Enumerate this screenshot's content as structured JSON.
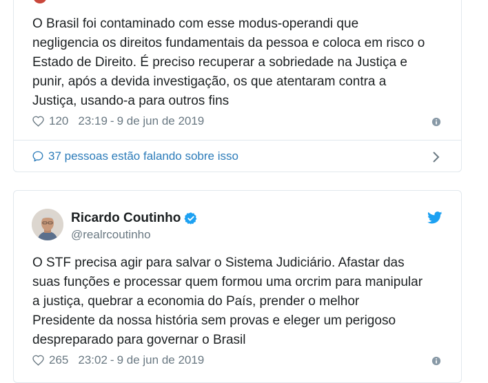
{
  "tweet1": {
    "text": "O Brasil foi contaminado com esse modus-operandi que\nnegligencia os direitos fundamentais da pessoa e coloca em risco o\nEstado de Direito. É preciso recuperar a sobriedade na Justiça e\npunir, após a devida investigação, os que atentaram contra a\nJustiça, usando-a para outros fins",
    "likes": "120",
    "time": "23:19",
    "date": "9 de jun de 2019",
    "conversation": "37 pessoas estão falando sobre isso"
  },
  "tweet2": {
    "author_name": "Ricardo Coutinho",
    "author_handle": "@realrcoutinho",
    "text": "O STF precisa agir para salvar o Sistema Judiciário. Afastar das\nsuas funções e processar quem formou uma orcrim para manipular\na justiça, quebrar a economia do País, prender o melhor\nPresidente da nossa história sem provas e eleger um perigoso\ndespreparado para governar o Brasil",
    "likes": "265",
    "time": "23:02",
    "date": "9 de jun de 2019"
  },
  "separator": "-",
  "icons": {
    "like": "heart-icon",
    "info": "info-icon",
    "conversation": "speech-bubble-icon",
    "expand": "chevron-right-icon",
    "verified": "verified-badge-icon",
    "brand": "twitter-bird-icon"
  },
  "colors": {
    "text": "#1c2022",
    "muted": "#697882",
    "link": "#2b7bb9",
    "verified": "#1da1f2",
    "border": "#e1e8ed"
  }
}
